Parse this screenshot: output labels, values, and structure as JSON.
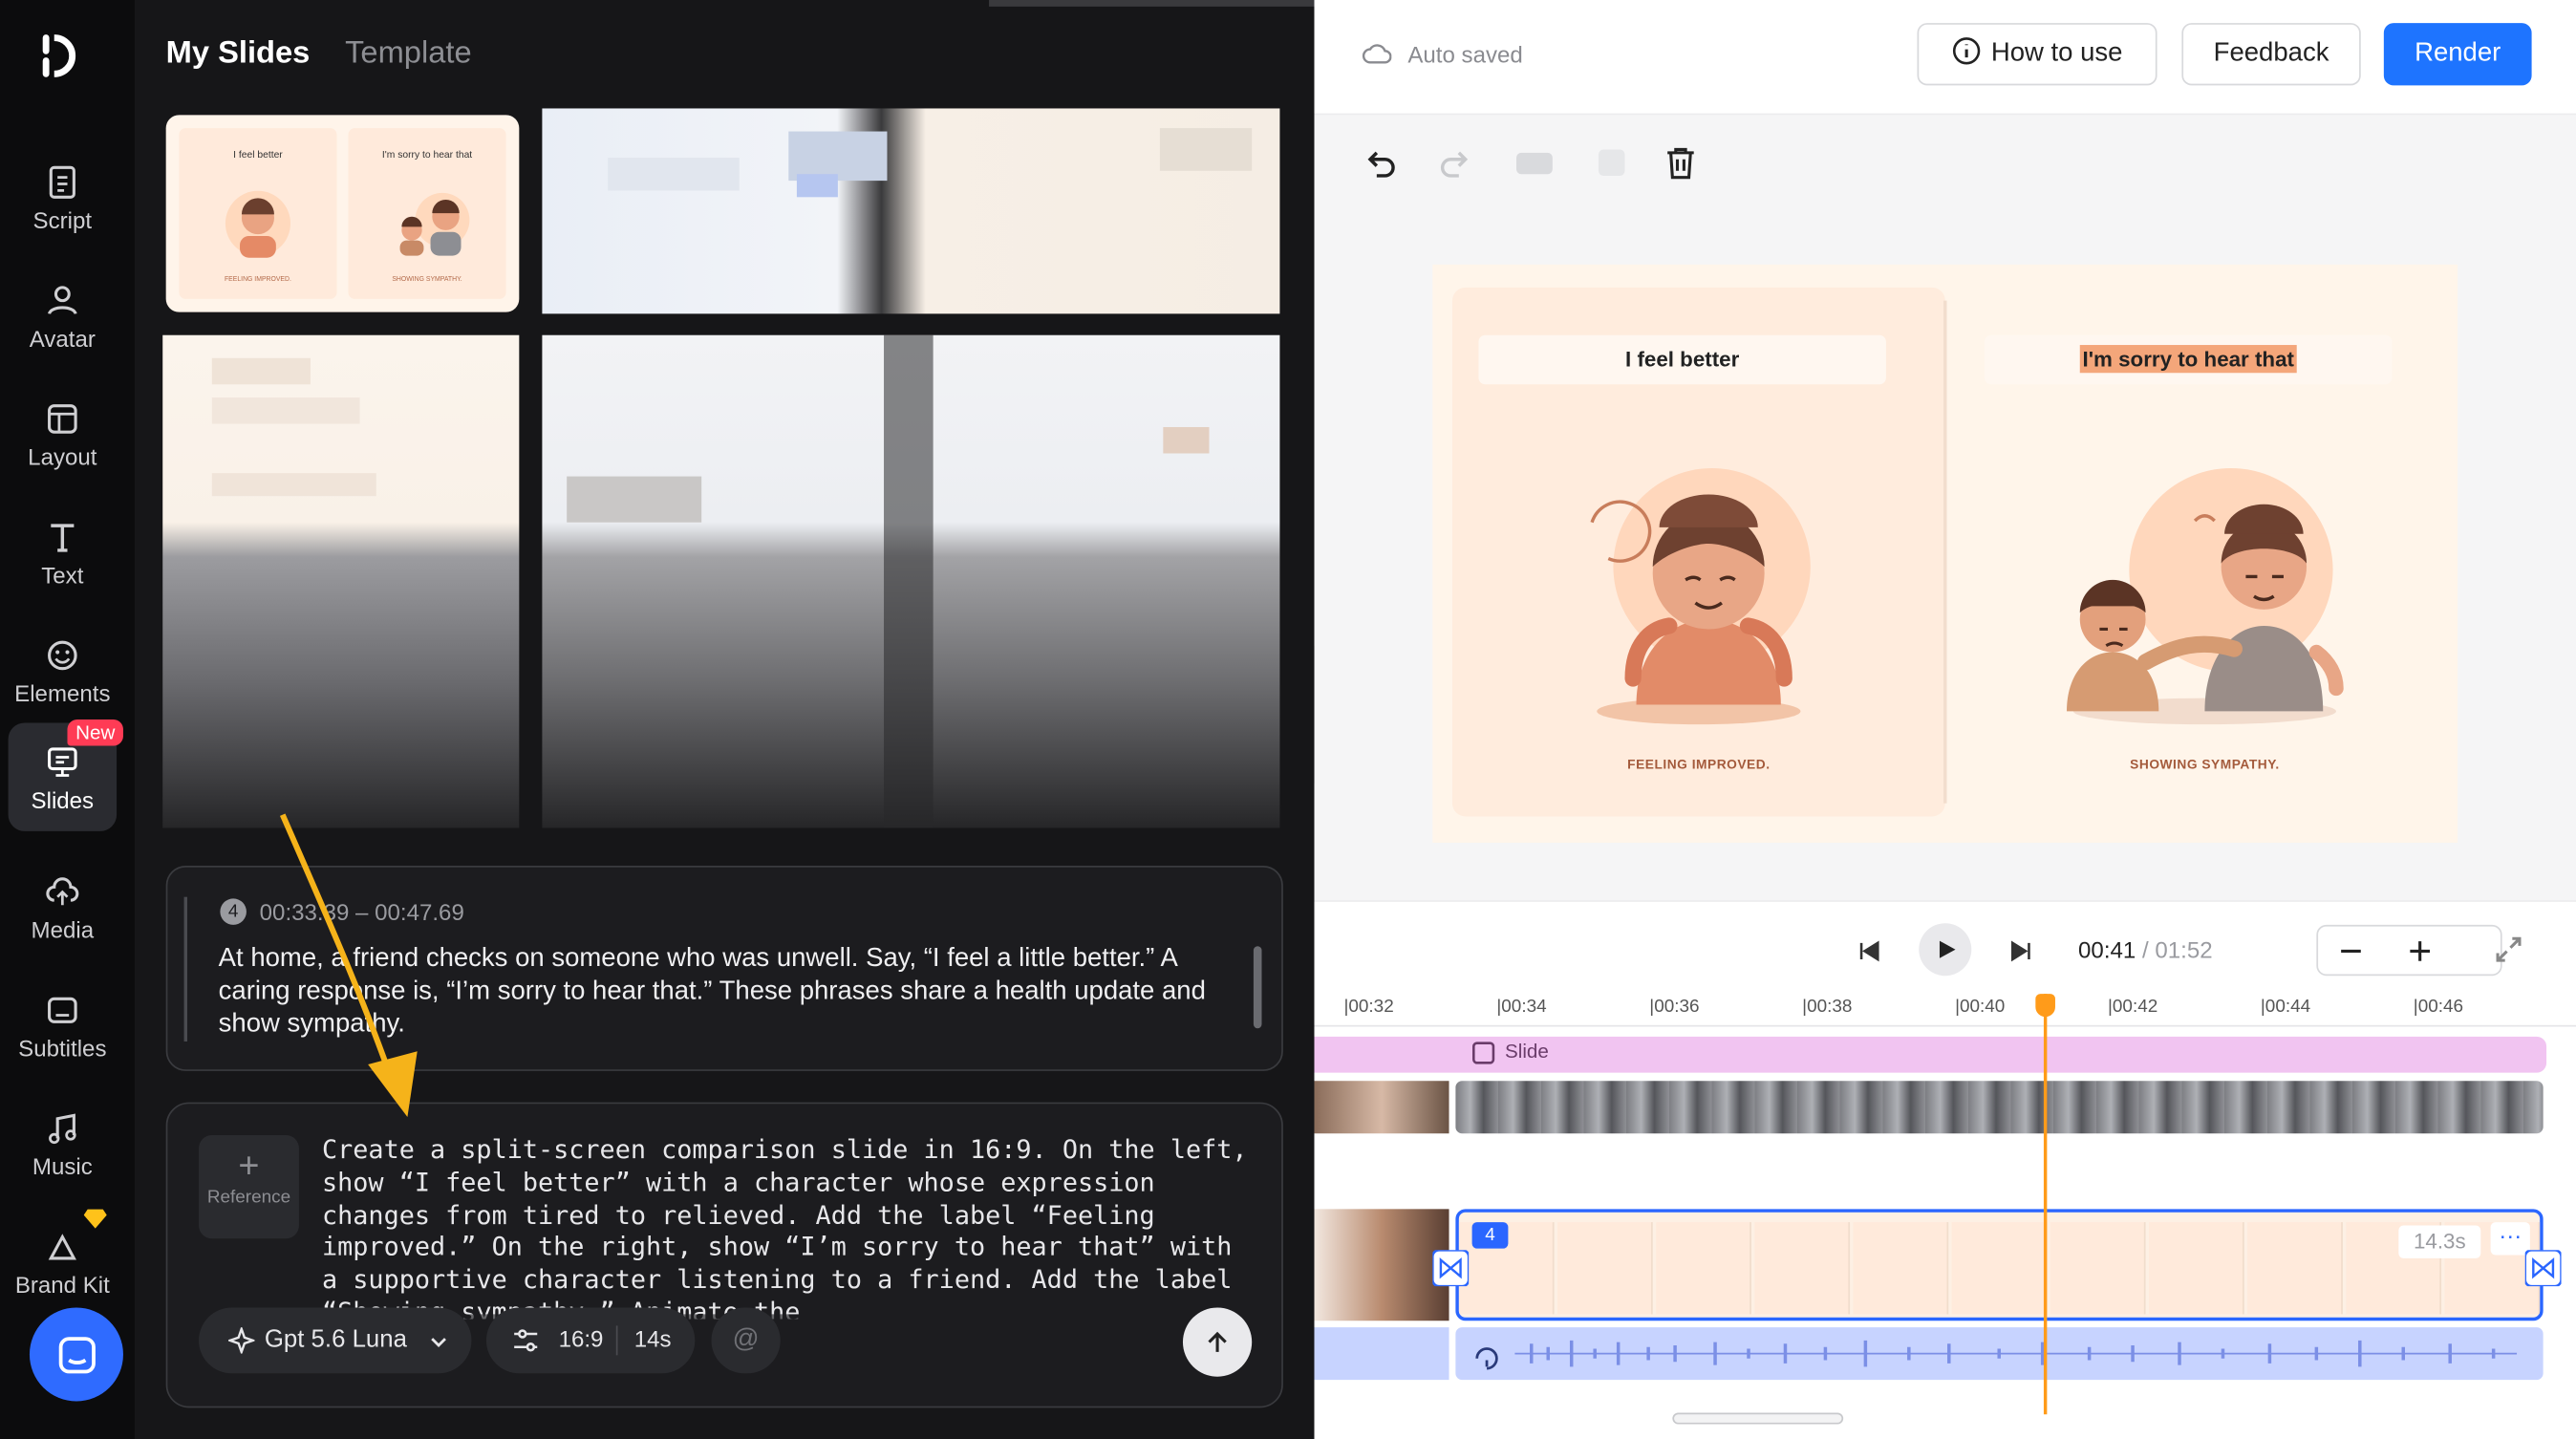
{
  "rail": {
    "items": [
      {
        "label": "Script",
        "icon": "script-icon"
      },
      {
        "label": "Avatar",
        "icon": "avatar-icon"
      },
      {
        "label": "Layout",
        "icon": "layout-icon"
      },
      {
        "label": "Text",
        "icon": "text-icon"
      },
      {
        "label": "Elements",
        "icon": "elements-icon"
      },
      {
        "label": "Slides",
        "icon": "slides-icon",
        "badge": "New",
        "active": true
      },
      {
        "label": "Media",
        "icon": "media-icon"
      },
      {
        "label": "Subtitles",
        "icon": "subtitles-icon"
      },
      {
        "label": "Music",
        "icon": "music-icon"
      },
      {
        "label": "Brand Kit",
        "icon": "brand-kit-icon"
      }
    ]
  },
  "panel": {
    "tabs": [
      "My Slides",
      "Template"
    ],
    "thumb": {
      "left": "I feel better",
      "right": "I'm sorry to hear that",
      "cap_left": "FEELING IMPROVED.",
      "cap_right": "SHOWING SYMPATHY."
    },
    "script": {
      "index": "4",
      "time": "00:33.39 – 00:47.69",
      "text": "At home, a friend checks on someone who was unwell. Say, “I feel a little better.” A caring response is, “I’m sorry to hear that.” These phrases share a health update and show sympathy."
    },
    "prompt": {
      "reference_label": "Reference",
      "text": "Create a split-screen comparison slide in 16:9. On the left, show “I feel better” with a character whose expression changes from tired to relieved. Add the label “Feeling improved.” On the right, show “I’m sorry to hear that” with a supportive character listening to a friend. Add the label “Showing sympathy.” Animate the",
      "model": "Gpt 5.6 Luna",
      "ratio": "16:9",
      "duration": "14s",
      "mention": "@"
    }
  },
  "editor": {
    "status": "Auto saved",
    "buttons": {
      "how_to": "How to use",
      "feedback": "Feedback",
      "render": "Render"
    },
    "slide": {
      "left_title": "I feel better",
      "right_title": "I'm sorry to hear that",
      "left_caption": "FEELING IMPROVED.",
      "right_caption": "SHOWING SYMPATHY."
    },
    "playback": {
      "current": "00:41",
      "separator": " / ",
      "total": "01:52"
    },
    "ruler": [
      "|00:32",
      "|00:34",
      "|00:36",
      "|00:38",
      "|00:40",
      "|00:42",
      "|00:44",
      "|00:46"
    ],
    "tracks": {
      "slide_label": "Slide",
      "slide_index": "4",
      "duration": "14.3s"
    }
  },
  "colors": {
    "accent": "#1e74ff",
    "playhead": "#ff9b1a",
    "badge": "#ff3b55"
  }
}
